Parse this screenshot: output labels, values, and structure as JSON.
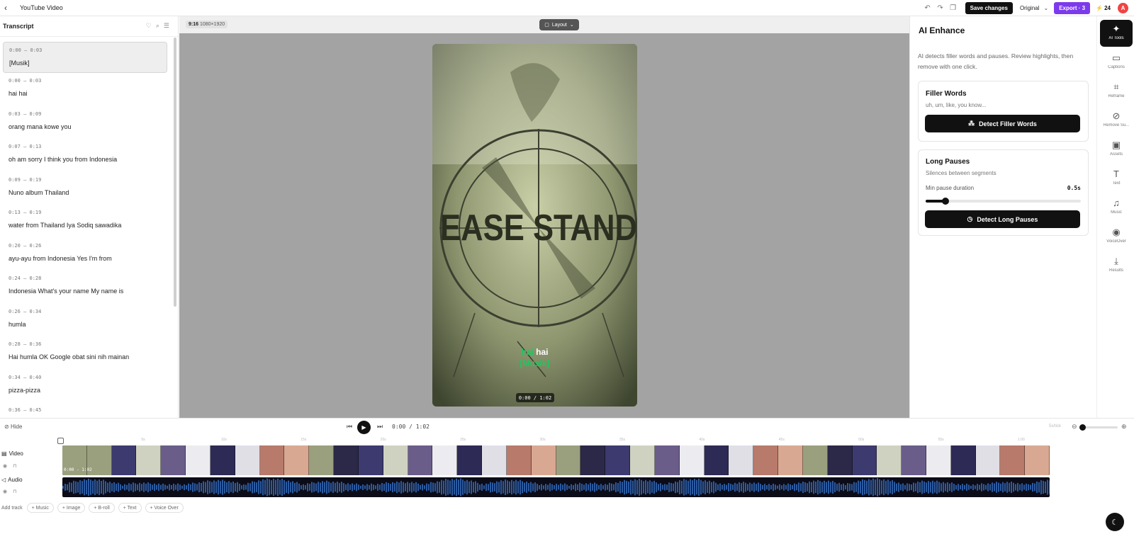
{
  "header": {
    "back_icon": "arrow-left-icon",
    "title": "YouTube Video",
    "save_label": "Save changes",
    "ratio_select": "Original",
    "export_label": "Export · 3",
    "credits": "24",
    "avatar_initial": "A"
  },
  "transcript": {
    "title": "Transcript",
    "segments": [
      {
        "time": "0:00 – 0:03",
        "text": "[Musik]"
      },
      {
        "time": "0:00 – 0:03",
        "text": "hai hai"
      },
      {
        "time": "0:03 – 0:09",
        "text": "orang mana kowe you"
      },
      {
        "time": "0:07 – 0:13",
        "text": "oh am sorry I think you from Indonesia"
      },
      {
        "time": "0:09 – 0:19",
        "text": "Nuno album Thailand"
      },
      {
        "time": "0:13 – 0:19",
        "text": "water from Thailand Iya Sodiq sawadika"
      },
      {
        "time": "0:20 – 0:26",
        "text": "ayu-ayu from Indonesia Yes I'm from"
      },
      {
        "time": "0:24 – 0:28",
        "text": "Indonesia What's your name My name is"
      },
      {
        "time": "0:26 – 0:34",
        "text": "humla"
      },
      {
        "time": "0:28 – 0:36",
        "text": "Hai humla OK Google obat sini nih mainan"
      },
      {
        "time": "0:34 – 0:40",
        "text": "pizza-pizza"
      },
      {
        "time": "0:36 – 0:45",
        "text": ""
      }
    ]
  },
  "preview": {
    "ratio_label": "9:16",
    "resolution": "1080×1920",
    "layout_label": "Layout",
    "video_text": "EASE STAND",
    "caption_line1_highlight": "hai",
    "caption_line1_rest": "hai",
    "caption_line2": "[Musik]",
    "time_display": "0:00 / 1:02"
  },
  "ai_panel": {
    "title": "AI Enhance",
    "description": "AI detects filler words and pauses. Review highlights, then remove with one click.",
    "filler": {
      "title": "Filler Words",
      "subtitle": "uh, um, like, you know...",
      "button": "Detect Filler Words"
    },
    "pauses": {
      "title": "Long Pauses",
      "subtitle": "Silences between segments",
      "slider_label": "Min pause duration",
      "slider_value": "0.5s",
      "slider_fraction": 0.13,
      "button": "Detect Long Pauses"
    }
  },
  "rail": {
    "items": [
      {
        "label": "AI Tools",
        "icon": "sparkles-icon",
        "glyph": "✦"
      },
      {
        "label": "Captions",
        "icon": "captions-icon",
        "glyph": "▭"
      },
      {
        "label": "Reframe",
        "icon": "crop-icon",
        "glyph": "⌗"
      },
      {
        "label": "Remove Su...",
        "icon": "eye-off-icon",
        "glyph": "⊘"
      },
      {
        "label": "Assets",
        "icon": "image-icon",
        "glyph": "▣"
      },
      {
        "label": "Text",
        "icon": "text-icon",
        "glyph": "T"
      },
      {
        "label": "Music",
        "icon": "music-icon",
        "glyph": "♫"
      },
      {
        "label": "VoiceOver",
        "icon": "mic-icon",
        "glyph": "◉"
      },
      {
        "label": "Results",
        "icon": "download-icon",
        "glyph": "⤓"
      }
    ]
  },
  "transport": {
    "hide_label": "Hide",
    "time": "0:00 / 1:02",
    "zoom_label": "5s/tick",
    "zoom_fraction": 0.0
  },
  "timeline": {
    "ticks": [
      "5s",
      "10s",
      "15s",
      "20s",
      "25s",
      "30s",
      "35s",
      "40s",
      "45s",
      "50s",
      "55s",
      "1:00"
    ],
    "video_label": "Video",
    "audio_label": "Audio",
    "thumb_timecode": "0:00 - 1:02",
    "add_track_label": "Add track",
    "chips": [
      "+ Music",
      "+ Image",
      "+ B-roll",
      "+ Text",
      "+ Voice Over"
    ]
  },
  "colors": {
    "accent_purple": "#7c3aed",
    "caption_green": "#22c55e",
    "audio_wave": "#2c5aa0"
  }
}
